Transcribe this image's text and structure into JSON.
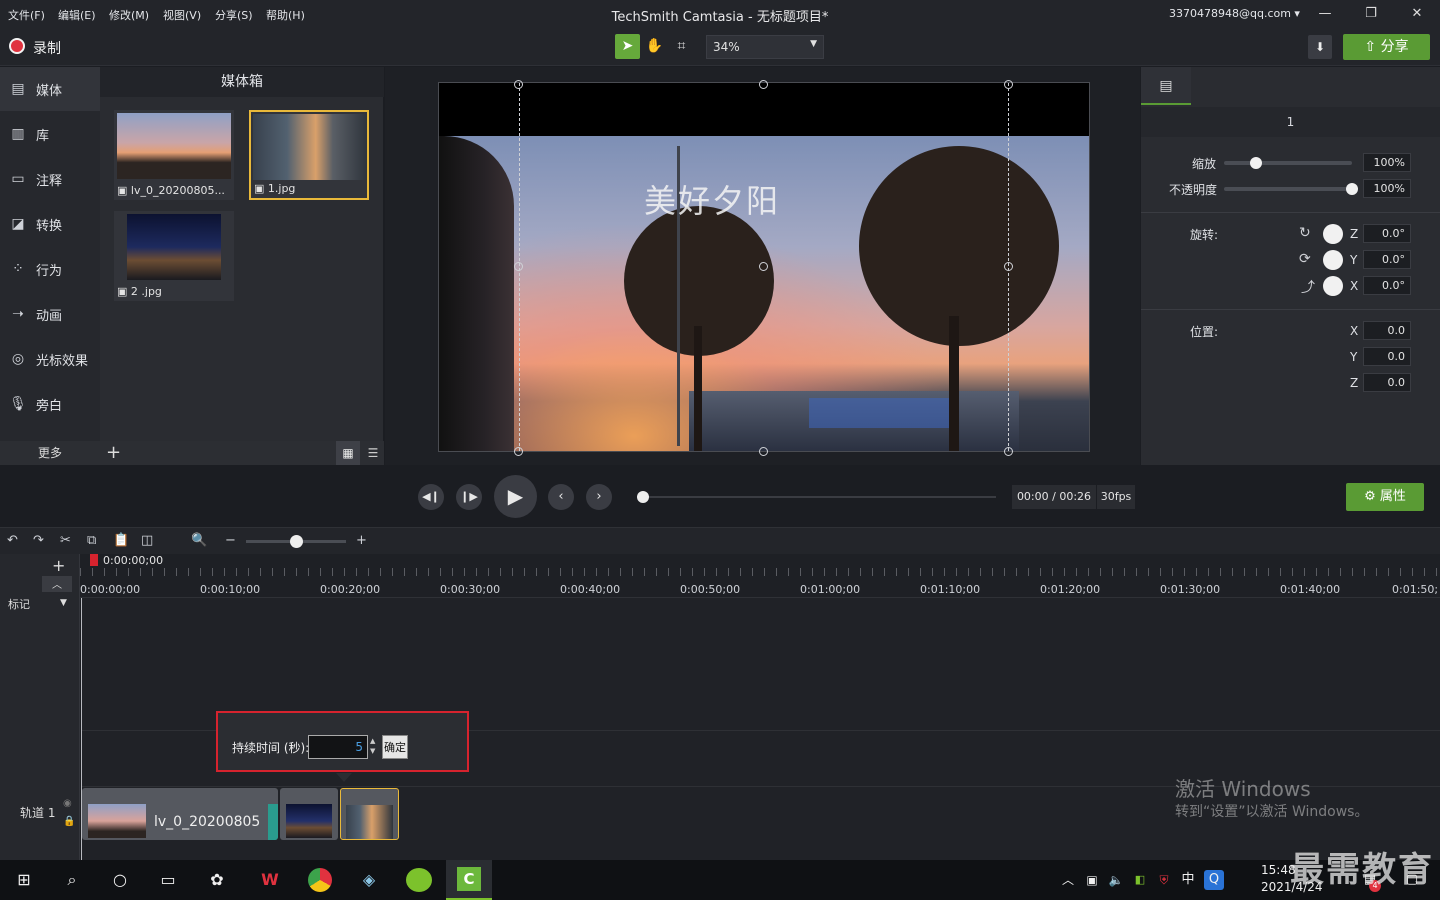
{
  "menu": [
    "文件(F)",
    "编辑(E)",
    "修改(M)",
    "视图(V)",
    "分享(S)",
    "帮助(H)"
  ],
  "window": {
    "title": "TechSmith Camtasia - 无标题项目*",
    "account": "3370478948@qq.com ▾"
  },
  "toolbar": {
    "record_label": "录制",
    "zoom": "34%",
    "share_label": "分享"
  },
  "sidebar": {
    "items": [
      {
        "label": "媒体",
        "icon": "film-icon"
      },
      {
        "label": "库",
        "icon": "library-icon"
      },
      {
        "label": "注释",
        "icon": "annotation-icon"
      },
      {
        "label": "转换",
        "icon": "transition-icon"
      },
      {
        "label": "行为",
        "icon": "behavior-icon"
      },
      {
        "label": "动画",
        "icon": "animation-icon"
      },
      {
        "label": "光标效果",
        "icon": "cursor-effect-icon"
      },
      {
        "label": "旁白",
        "icon": "microphone-icon"
      }
    ],
    "more_label": "更多"
  },
  "mediabin": {
    "title": "媒体箱",
    "items": [
      {
        "name": "lv_0_20200805...",
        "type": "video"
      },
      {
        "name": "1.jpg",
        "type": "image",
        "selected": true
      },
      {
        "name": "2 .jpg",
        "type": "image"
      }
    ]
  },
  "canvas": {
    "overlay_text": "美好夕阳"
  },
  "properties": {
    "header": "1",
    "scale_label": "缩放",
    "scale_value": "100%",
    "scale_level": 0.25,
    "opacity_label": "不透明度",
    "opacity_value": "100%",
    "opacity_level": 1.0,
    "rotation_label": "旋转:",
    "rotation": [
      {
        "axis": "Z",
        "value": "0.0°"
      },
      {
        "axis": "Y",
        "value": "0.0°"
      },
      {
        "axis": "X",
        "value": "0.0°"
      }
    ],
    "position_label": "位置:",
    "position": [
      {
        "axis": "X",
        "value": "0.0"
      },
      {
        "axis": "Y",
        "value": "0.0"
      },
      {
        "axis": "Z",
        "value": "0.0"
      }
    ]
  },
  "playback": {
    "timecode": "00:00 / 00:26",
    "fps": "30fps",
    "props_label": "属性"
  },
  "timeline": {
    "playhead": "0:00:00;00",
    "marks_label": "标记",
    "ticks": [
      "0:00:00;00",
      "0:00:10;00",
      "0:00:20;00",
      "0:00:30;00",
      "0:00:40;00",
      "0:00:50;00",
      "0:01:00;00",
      "0:01:10;00",
      "0:01:20;00",
      "0:01:30;00",
      "0:01:40;00",
      "0:01:50;"
    ],
    "track_label": "轨道 1",
    "clip1_name": "lv_0_20200805"
  },
  "duration_dialog": {
    "label": "持续时间 (秒):",
    "value": "5",
    "ok_label": "确定"
  },
  "watermark": {
    "line1": "激活 Windows",
    "line2": "转到“设置”以激活 Windows。"
  },
  "taskbar": {
    "time": "15:48",
    "date": "2021/4/24",
    "ime": "中",
    "brand": "最需教育",
    "notif_count": "4"
  },
  "colors": {
    "accent_green": "#5a9b34",
    "selection_yellow": "#e9b93a",
    "record_red": "#e0323f",
    "dialog_border": "#d6232e"
  }
}
